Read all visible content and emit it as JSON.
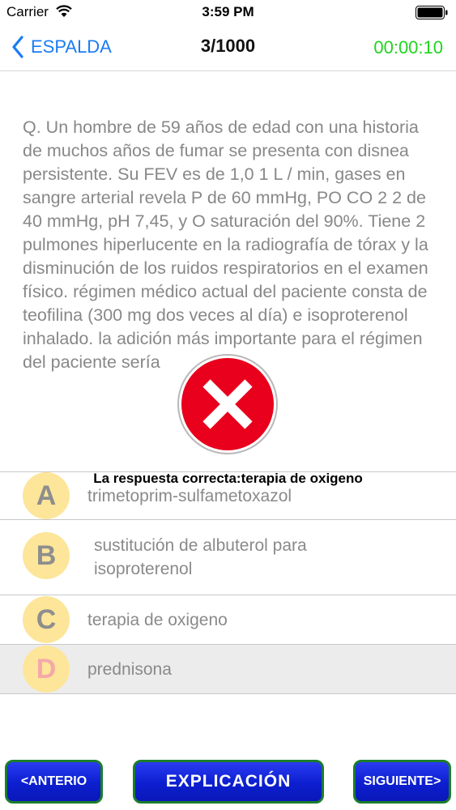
{
  "status_bar": {
    "carrier": "Carrier",
    "time": "3:59 PM"
  },
  "nav": {
    "back_label": "ESPALDA",
    "progress": "3/1000",
    "timer": "00:00:10",
    "timer_color": "#1ed61e",
    "accent": "#1a7cf5"
  },
  "question": {
    "text": "Q. Un hombre de 59 años de edad con una historia de muchos años de fumar se presenta con disnea persistente. Su FEV es de 1,0 1 L / min, gases en sangre arterial revela P de 60 mmHg, PO CO 2 2 de 40 mmHg, pH 7,45, y O saturación del 90%. Tiene 2 pulmones hiperlucente en la radiografía de tórax y la disminución de los ruidos respiratorios en el examen físico. régimen médico actual del paciente consta de teofilina (300 mg dos veces al día) e isoproterenol inhalado. la adición más importante para el régimen del paciente sería"
  },
  "feedback": {
    "correct_answer": "La respuesta correcta:terapia de oxigeno",
    "wrong_icon": "wrong-x-icon",
    "wrong_color": "#e8001c"
  },
  "options": [
    {
      "letter": "A",
      "text": "trimetoprim-sulfametoxazol"
    },
    {
      "letter": "B",
      "text": "sustitución de albuterol para isoproterenol"
    },
    {
      "letter": "C",
      "text": "terapia de oxigeno"
    },
    {
      "letter": "D",
      "text": "prednisona"
    }
  ],
  "buttons": {
    "prev": "<ANTERIO",
    "explanation": "EXPLICACIÓN",
    "next": "SIGUIENTE>"
  }
}
